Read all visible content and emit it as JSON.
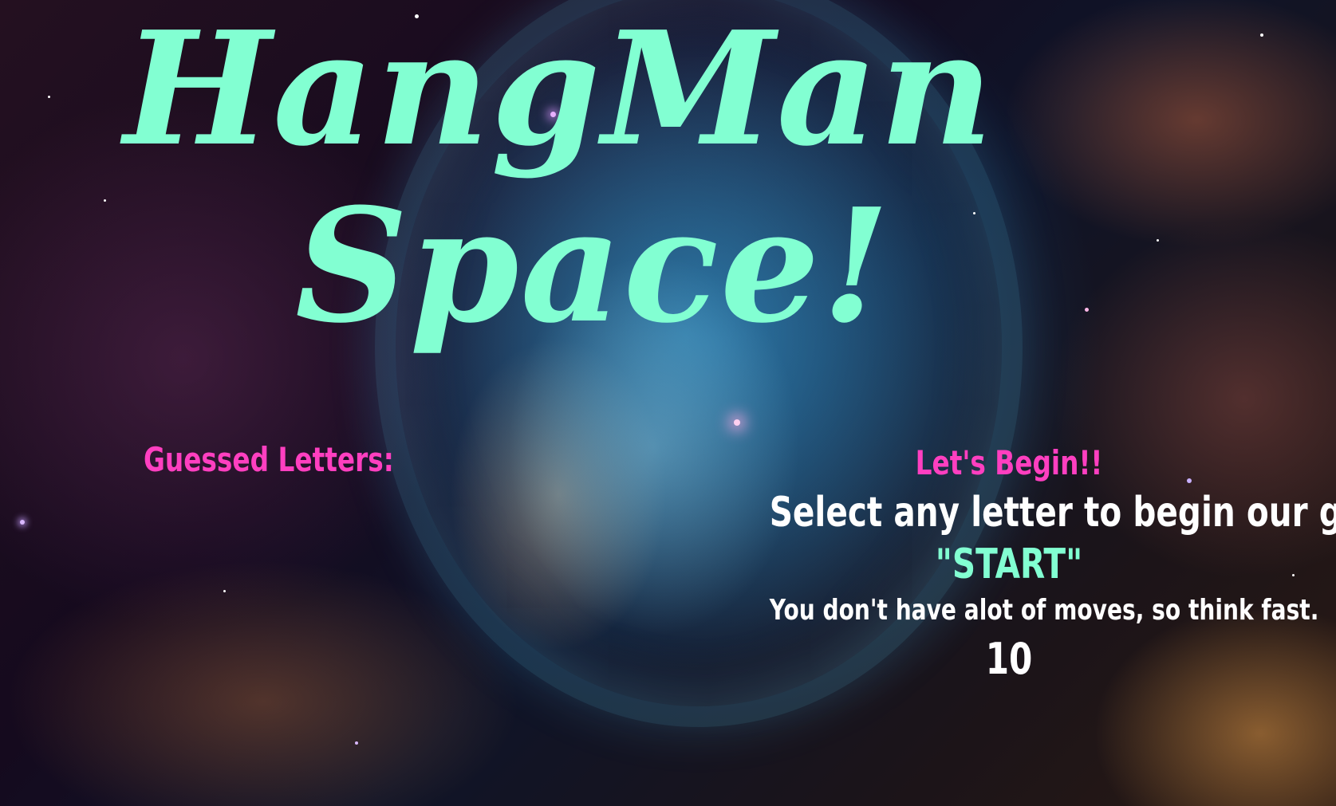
{
  "title": {
    "line1": "HangMan",
    "line2": "Space!"
  },
  "guessed": {
    "label": "Guessed Letters:",
    "letters": ""
  },
  "game": {
    "status": "Let's Begin!!",
    "instruction": "Select any letter to begin our game!",
    "word": "\"START\"",
    "hint": "You don't have alot of moves, so think fast.",
    "moves_left": "10"
  },
  "colors": {
    "title": "#82ffd2",
    "accent_pink": "#ff3fc0",
    "text_white": "#ffffff"
  },
  "background": "nebula-space-image"
}
